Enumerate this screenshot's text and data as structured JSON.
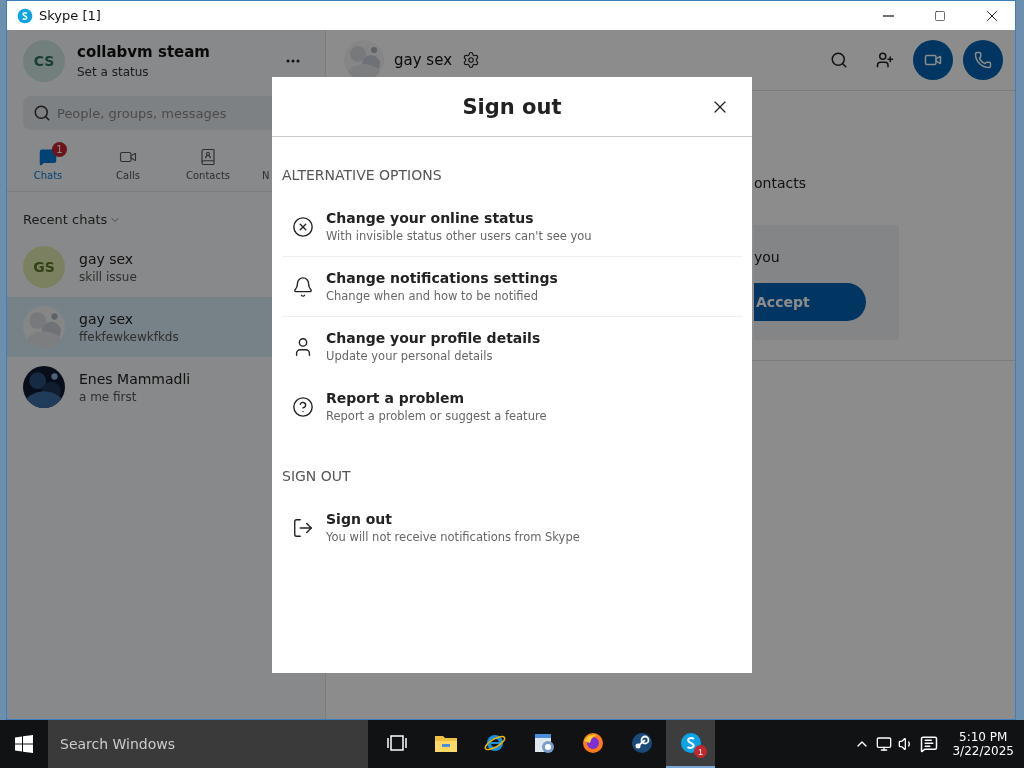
{
  "window": {
    "title": "Skype [1]"
  },
  "profile": {
    "initials": "CS",
    "name": "collabvm steam",
    "status": "Set a status"
  },
  "search": {
    "placeholder": "People, groups, messages"
  },
  "nav_tabs": [
    {
      "kind": "chats",
      "label": "Chats",
      "selected": true,
      "badge": "1"
    },
    {
      "kind": "calls",
      "label": "Calls",
      "selected": false
    },
    {
      "kind": "contacts",
      "label": "Contacts",
      "selected": false
    },
    {
      "kind": "other",
      "label": "N",
      "selected": false
    }
  ],
  "recent_chats": {
    "title": "Recent chats",
    "items": [
      {
        "kind": "initials",
        "initials": "GS",
        "name": "gay sex",
        "preview": "skill issue",
        "selected": false
      },
      {
        "kind": "picture",
        "name": "gay sex",
        "preview": "ffekfewkewkfkds",
        "selected": true
      },
      {
        "kind": "picture",
        "name": "Enes Mammadli",
        "preview": "a me first",
        "selected": false
      }
    ]
  },
  "conversation": {
    "title": "gay sex",
    "fragment_1": "ontacts",
    "card_text": "you",
    "card_button": "Accept"
  },
  "dialog": {
    "title": "Sign out",
    "sections": [
      {
        "heading": "ALTERNATIVE OPTIONS",
        "options": [
          {
            "kind": "status",
            "title": "Change your online status",
            "subtitle": "With invisible status other users can't see you"
          },
          {
            "kind": "notifications",
            "title": "Change notifications settings",
            "subtitle": "Change when and how to be notified"
          },
          {
            "kind": "profile",
            "title": "Change your profile details",
            "subtitle": "Update your personal details"
          },
          {
            "kind": "problem",
            "title": "Report a problem",
            "subtitle": "Report a problem or suggest a feature"
          }
        ]
      },
      {
        "heading": "SIGN OUT",
        "options": [
          {
            "kind": "signout",
            "title": "Sign out",
            "subtitle": "You will not receive notifications from Skype"
          }
        ]
      }
    ]
  },
  "taskbar": {
    "search_placeholder": "Search Windows",
    "apps": [
      {
        "kind": "taskview",
        "selected": false
      },
      {
        "kind": "files",
        "selected": false
      },
      {
        "kind": "browser",
        "selected": false
      },
      {
        "kind": "tool",
        "selected": false
      },
      {
        "kind": "firefox",
        "selected": false
      },
      {
        "kind": "steam",
        "selected": false
      },
      {
        "kind": "skype",
        "selected": true,
        "badge": "1"
      }
    ],
    "time": "5:10 PM",
    "date": "3/22/2025"
  }
}
